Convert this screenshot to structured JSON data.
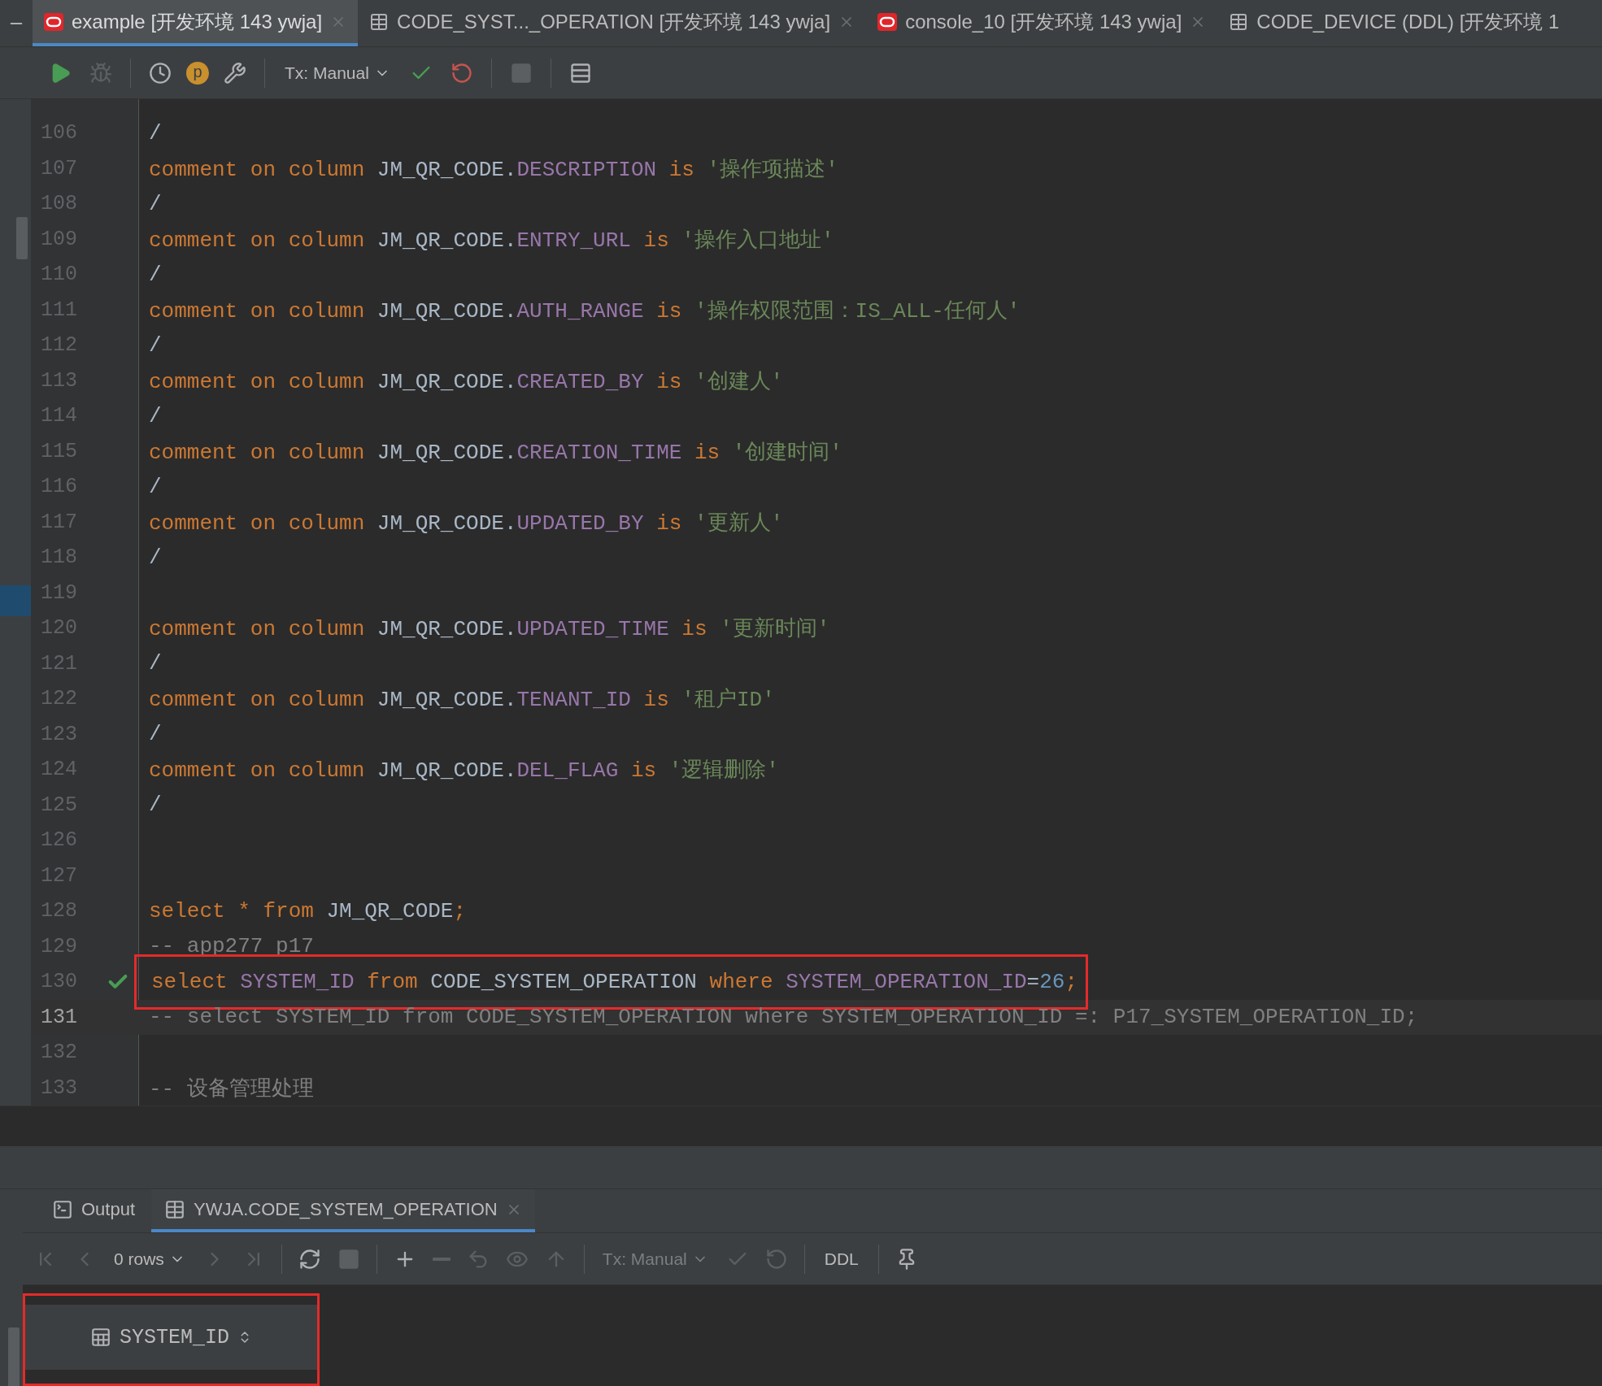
{
  "tabs": [
    {
      "label": "example [开发环境 143 ywja]",
      "kind": "console",
      "selected": true,
      "closable": true
    },
    {
      "label": "CODE_SYST..._OPERATION [开发环境 143 ywja]",
      "kind": "table",
      "selected": false,
      "closable": true
    },
    {
      "label": "console_10 [开发环境 143 ywja]",
      "kind": "console",
      "selected": false,
      "closable": true
    },
    {
      "label": "CODE_DEVICE (DDL) [开发环境 1",
      "kind": "table",
      "selected": false,
      "closable": false
    }
  ],
  "toolbar": {
    "items": [
      {
        "kind": "run",
        "disabled": false
      },
      {
        "kind": "debug",
        "disabled": true
      },
      {
        "kind": "separator"
      },
      {
        "kind": "history"
      },
      {
        "kind": "badge",
        "label": "p"
      },
      {
        "kind": "settings"
      },
      {
        "kind": "separator"
      },
      {
        "kind": "dropdown",
        "label": "Tx: Manual",
        "disabled": false
      },
      {
        "kind": "commit",
        "disabled": false
      },
      {
        "kind": "rollback",
        "disabled": false
      },
      {
        "kind": "separator"
      },
      {
        "kind": "stop",
        "disabled": true
      },
      {
        "kind": "separator"
      },
      {
        "kind": "view"
      }
    ]
  },
  "editor": {
    "lines": [
      {
        "number": "106",
        "current": false,
        "executed": false,
        "tokens": [
          {
            "kind": "id",
            "text": "/"
          }
        ]
      },
      {
        "number": "107",
        "current": false,
        "executed": false,
        "tokens": [
          {
            "kind": "kw",
            "text": "comment on column "
          },
          {
            "kind": "id",
            "text": "JM_QR_CODE."
          },
          {
            "kind": "field",
            "text": "DESCRIPTION"
          },
          {
            "kind": "kw",
            "text": " is "
          },
          {
            "kind": "str",
            "text": "'操作项描述'"
          }
        ]
      },
      {
        "number": "108",
        "current": false,
        "executed": false,
        "tokens": [
          {
            "kind": "id",
            "text": "/"
          }
        ]
      },
      {
        "number": "109",
        "current": false,
        "executed": false,
        "tokens": [
          {
            "kind": "kw",
            "text": "comment on column "
          },
          {
            "kind": "id",
            "text": "JM_QR_CODE."
          },
          {
            "kind": "field",
            "text": "ENTRY_URL"
          },
          {
            "kind": "kw",
            "text": " is "
          },
          {
            "kind": "str",
            "text": "'操作入口地址'"
          }
        ]
      },
      {
        "number": "110",
        "current": false,
        "executed": false,
        "tokens": [
          {
            "kind": "id",
            "text": "/"
          }
        ]
      },
      {
        "number": "111",
        "current": false,
        "executed": false,
        "tokens": [
          {
            "kind": "kw",
            "text": "comment on column "
          },
          {
            "kind": "id",
            "text": "JM_QR_CODE."
          },
          {
            "kind": "field",
            "text": "AUTH_RANGE"
          },
          {
            "kind": "kw",
            "text": " is "
          },
          {
            "kind": "str",
            "text": "'操作权限范围：IS_ALL-任何人'"
          }
        ]
      },
      {
        "number": "112",
        "current": false,
        "executed": false,
        "tokens": [
          {
            "kind": "id",
            "text": "/"
          }
        ]
      },
      {
        "number": "113",
        "current": false,
        "executed": false,
        "tokens": [
          {
            "kind": "kw",
            "text": "comment on column "
          },
          {
            "kind": "id",
            "text": "JM_QR_CODE."
          },
          {
            "kind": "field",
            "text": "CREATED_BY"
          },
          {
            "kind": "kw",
            "text": " is "
          },
          {
            "kind": "str",
            "text": "'创建人'"
          }
        ]
      },
      {
        "number": "114",
        "current": false,
        "executed": false,
        "tokens": [
          {
            "kind": "id",
            "text": "/"
          }
        ]
      },
      {
        "number": "115",
        "current": false,
        "executed": false,
        "tokens": [
          {
            "kind": "kw",
            "text": "comment on column "
          },
          {
            "kind": "id",
            "text": "JM_QR_CODE."
          },
          {
            "kind": "field",
            "text": "CREATION_TIME"
          },
          {
            "kind": "kw",
            "text": " is "
          },
          {
            "kind": "str",
            "text": "'创建时间'"
          }
        ]
      },
      {
        "number": "116",
        "current": false,
        "executed": false,
        "tokens": [
          {
            "kind": "id",
            "text": "/"
          }
        ]
      },
      {
        "number": "117",
        "current": false,
        "executed": false,
        "tokens": [
          {
            "kind": "kw",
            "text": "comment on column "
          },
          {
            "kind": "id",
            "text": "JM_QR_CODE."
          },
          {
            "kind": "field",
            "text": "UPDATED_BY"
          },
          {
            "kind": "kw",
            "text": " is "
          },
          {
            "kind": "str",
            "text": "'更新人'"
          }
        ]
      },
      {
        "number": "118",
        "current": false,
        "executed": false,
        "tokens": [
          {
            "kind": "id",
            "text": "/"
          }
        ]
      },
      {
        "number": "119",
        "current": false,
        "executed": false
      },
      {
        "number": "120",
        "current": false,
        "executed": false,
        "tokens": [
          {
            "kind": "kw",
            "text": "comment on column "
          },
          {
            "kind": "id",
            "text": "JM_QR_CODE."
          },
          {
            "kind": "field",
            "text": "UPDATED_TIME"
          },
          {
            "kind": "kw",
            "text": " is "
          },
          {
            "kind": "str",
            "text": "'更新时间'"
          }
        ]
      },
      {
        "number": "121",
        "current": false,
        "executed": false,
        "tokens": [
          {
            "kind": "id",
            "text": "/"
          }
        ]
      },
      {
        "number": "122",
        "current": false,
        "executed": false,
        "tokens": [
          {
            "kind": "kw",
            "text": "comment on column "
          },
          {
            "kind": "id",
            "text": "JM_QR_CODE."
          },
          {
            "kind": "field",
            "text": "TENANT_ID"
          },
          {
            "kind": "kw",
            "text": " is "
          },
          {
            "kind": "str",
            "text": "'租户ID'"
          }
        ]
      },
      {
        "number": "123",
        "current": false,
        "executed": false,
        "tokens": [
          {
            "kind": "id",
            "text": "/"
          }
        ]
      },
      {
        "number": "124",
        "current": false,
        "executed": false,
        "tokens": [
          {
            "kind": "kw",
            "text": "comment on column "
          },
          {
            "kind": "id",
            "text": "JM_QR_CODE."
          },
          {
            "kind": "field",
            "text": "DEL_FLAG"
          },
          {
            "kind": "kw",
            "text": " is "
          },
          {
            "kind": "str",
            "text": "'逻辑删除'"
          }
        ]
      },
      {
        "number": "125",
        "current": false,
        "executed": false,
        "tokens": [
          {
            "kind": "id",
            "text": "/"
          }
        ]
      },
      {
        "number": "126",
        "current": false,
        "executed": false
      },
      {
        "number": "127",
        "current": false,
        "executed": false
      },
      {
        "number": "128",
        "current": false,
        "executed": false,
        "tokens": [
          {
            "kind": "kw",
            "text": "select * from "
          },
          {
            "kind": "id",
            "text": "JM_QR_CODE"
          },
          {
            "kind": "kw",
            "text": ";"
          }
        ]
      },
      {
        "number": "129",
        "current": false,
        "executed": false,
        "tokens": [
          {
            "kind": "cmt",
            "text": "-- app277 p17"
          }
        ]
      },
      {
        "number": "130",
        "current": false,
        "executed": true,
        "annotated": true,
        "tokens": [
          {
            "kind": "kw",
            "text": "select "
          },
          {
            "kind": "field",
            "text": "SYSTEM_ID"
          },
          {
            "kind": "kw",
            "text": " from "
          },
          {
            "kind": "id",
            "text": "CODE_SYSTEM_OPERATION"
          },
          {
            "kind": "kw",
            "text": " where "
          },
          {
            "kind": "field",
            "text": "SYSTEM_OPERATION_ID"
          },
          {
            "kind": "id",
            "text": "="
          },
          {
            "kind": "num",
            "text": "26"
          },
          {
            "kind": "kw",
            "text": ";"
          }
        ]
      },
      {
        "number": "131",
        "current": true,
        "executed": false,
        "tokens": [
          {
            "kind": "cmt",
            "text": "-- select SYSTEM_ID from CODE_SYSTEM_OPERATION where SYSTEM_OPERATION_ID =: P17_SYSTEM_OPERATION_ID;"
          }
        ]
      },
      {
        "number": "132",
        "current": false,
        "executed": false
      },
      {
        "number": "133",
        "current": false,
        "executed": false,
        "tokens": [
          {
            "kind": "cmt",
            "text": "-- 设备管理处理"
          }
        ]
      }
    ]
  },
  "bottom_panel": {
    "tabs": [
      {
        "label": "Output",
        "kind": "output",
        "selected": false,
        "closable": false
      },
      {
        "label": "YWJA.CODE_SYSTEM_OPERATION",
        "kind": "table",
        "selected": true,
        "closable": true
      }
    ],
    "toolbar": {
      "items": [
        {
          "kind": "first",
          "disabled": true
        },
        {
          "kind": "prev",
          "disabled": true
        },
        {
          "kind": "dropdown",
          "label": "0 rows",
          "disabled": false
        },
        {
          "kind": "next",
          "disabled": true
        },
        {
          "kind": "last",
          "disabled": true
        },
        {
          "kind": "separator"
        },
        {
          "kind": "refresh",
          "disabled": false
        },
        {
          "kind": "stop",
          "disabled": true
        },
        {
          "kind": "separator"
        },
        {
          "kind": "add",
          "disabled": false
        },
        {
          "kind": "remove",
          "disabled": true
        },
        {
          "kind": "revert",
          "disabled": true
        },
        {
          "kind": "preview",
          "disabled": true
        },
        {
          "kind": "submit",
          "disabled": true
        },
        {
          "kind": "separator"
        },
        {
          "kind": "dropdown",
          "label": "Tx: Manual",
          "disabled": true
        },
        {
          "kind": "commit",
          "disabled": true
        },
        {
          "kind": "rollback",
          "disabled": true
        },
        {
          "kind": "separator"
        },
        {
          "kind": "text",
          "label": "DDL"
        },
        {
          "kind": "separator"
        },
        {
          "kind": "pin",
          "disabled": false
        }
      ]
    },
    "columns": [
      {
        "label": "SYSTEM_ID",
        "annotated": true
      }
    ]
  }
}
